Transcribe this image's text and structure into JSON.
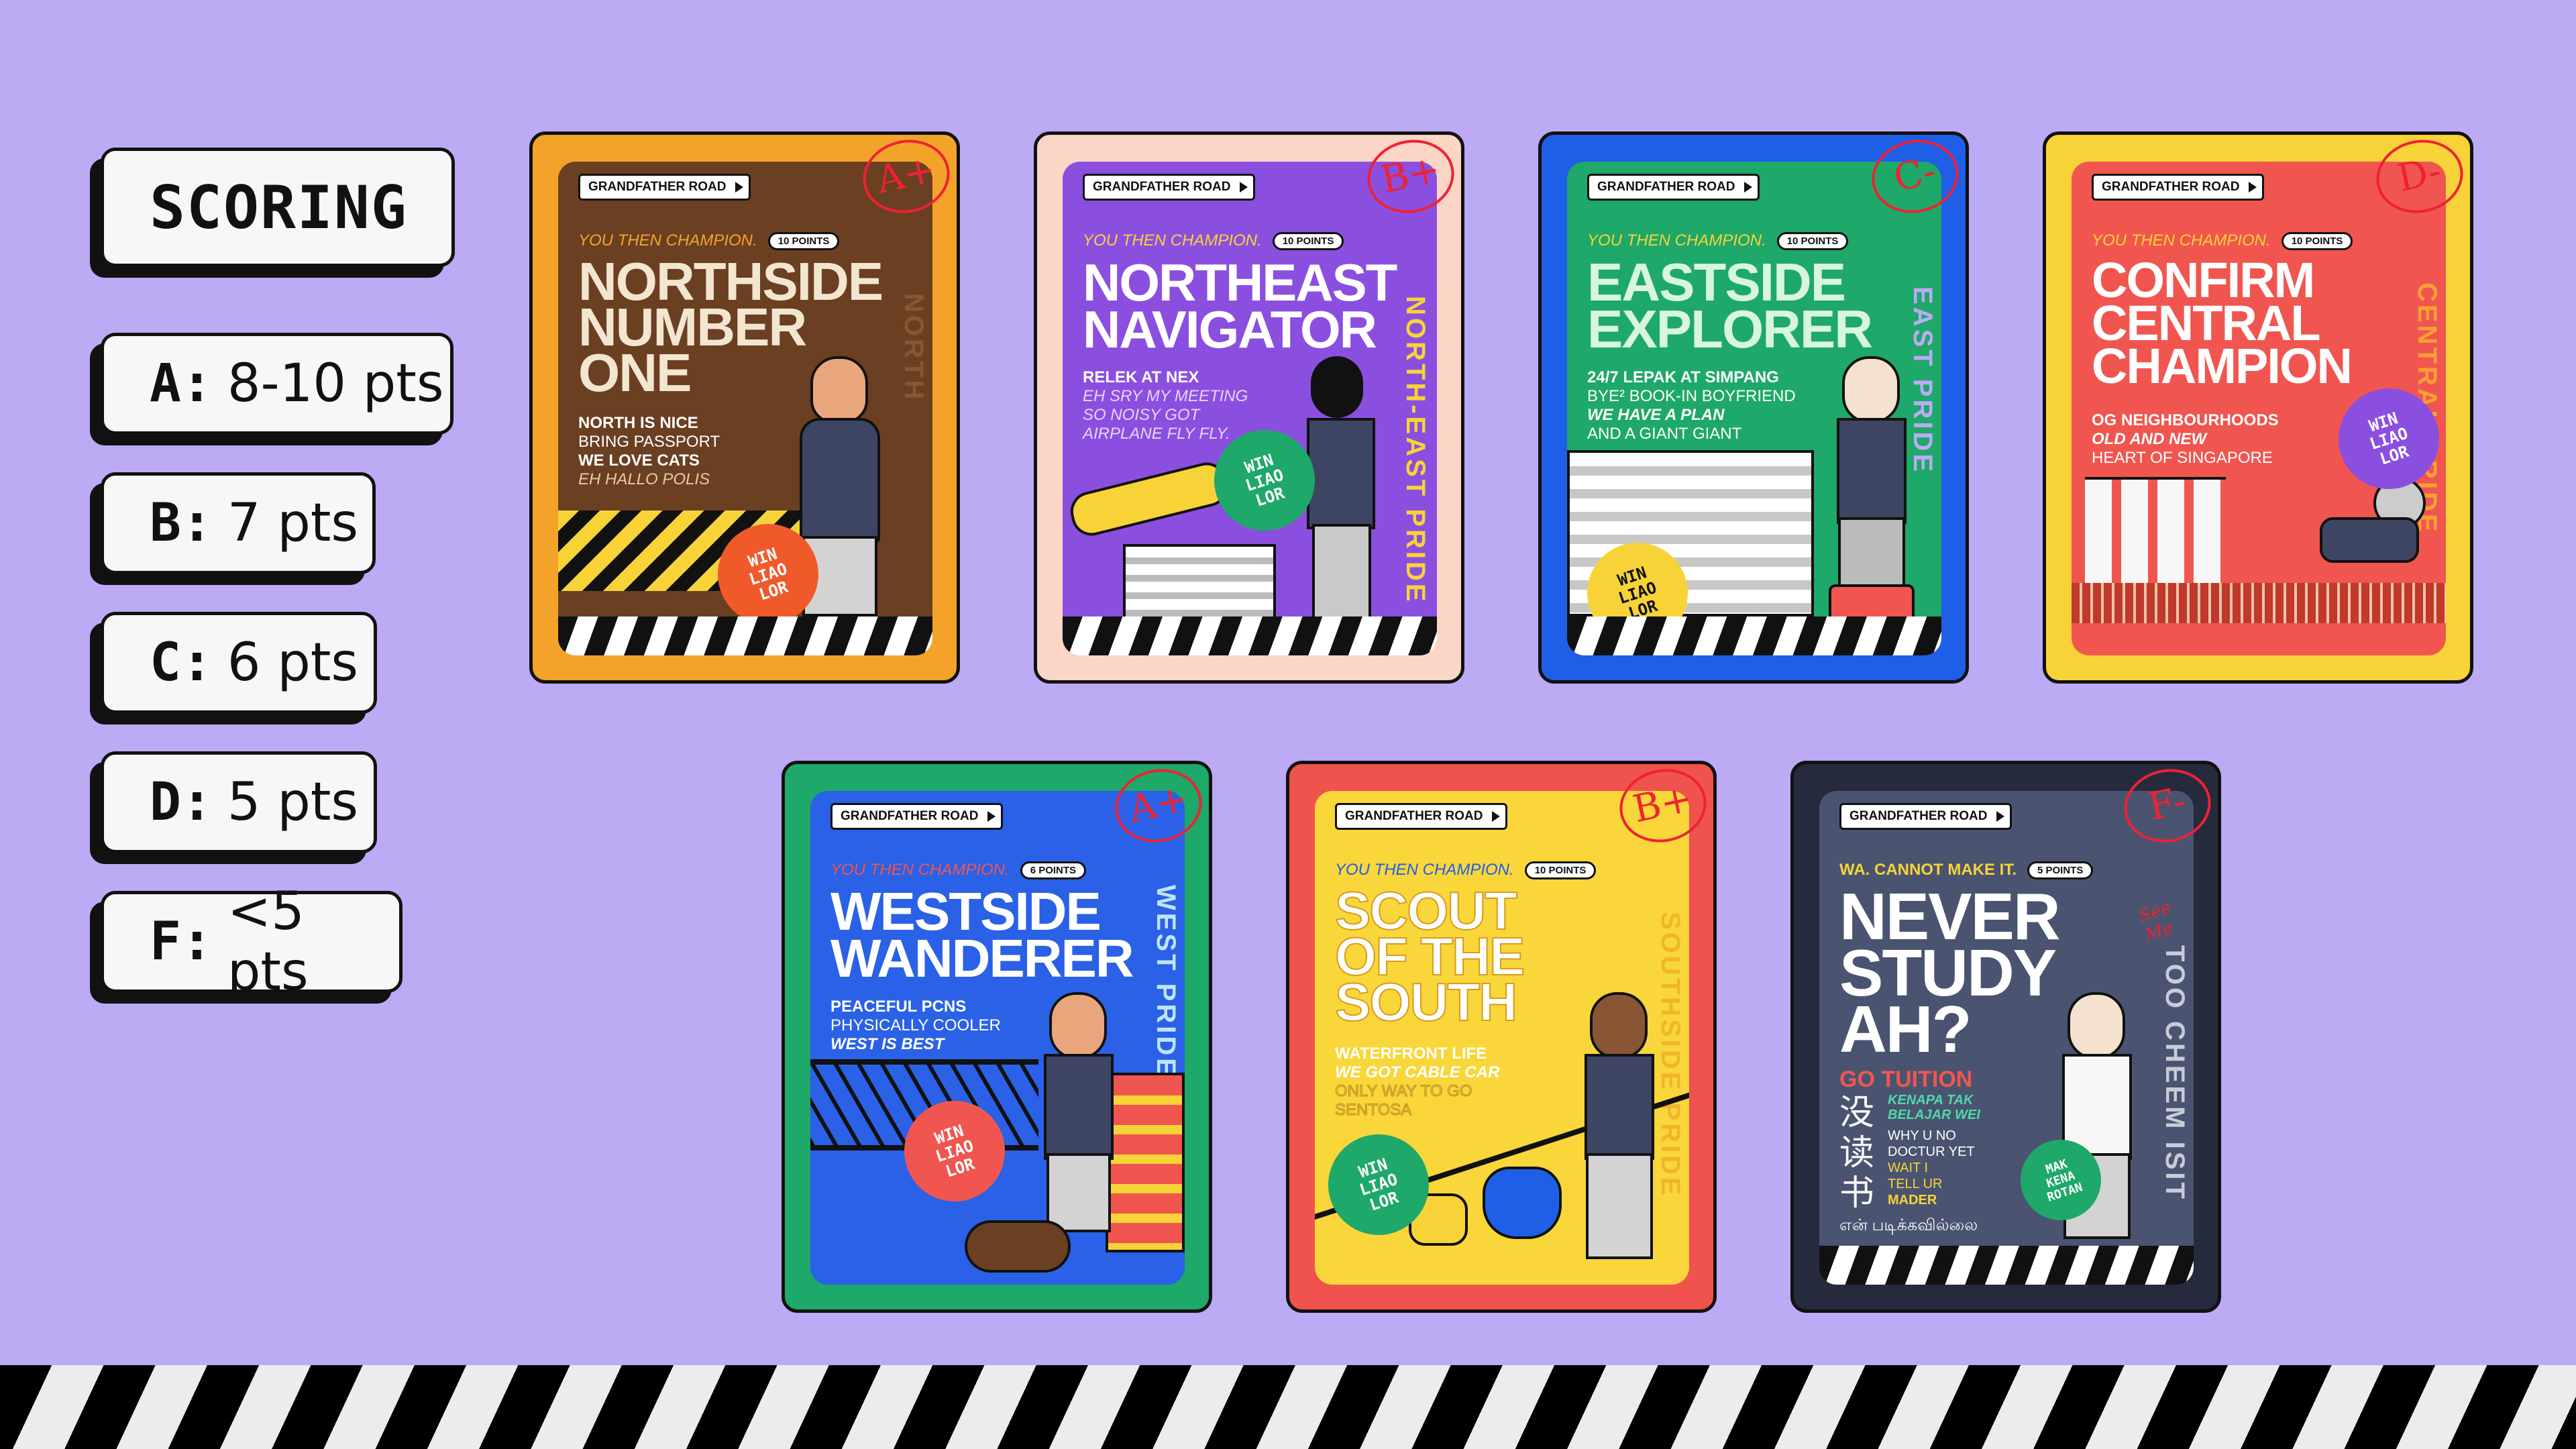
{
  "scoring": {
    "title": "SCORING",
    "grades": [
      {
        "letter": "A:",
        "points": "8-10 pts"
      },
      {
        "letter": "B:",
        "points": "7 pts"
      },
      {
        "letter": "C:",
        "points": "6 pts"
      },
      {
        "letter": "D:",
        "points": "5 pts"
      },
      {
        "letter": "F:",
        "points": "<5 pts"
      }
    ]
  },
  "cards": [
    {
      "brand": "GRANDFATHER ROAD",
      "tagline": "YOU THEN CHAMPION.",
      "points": "10 POINTS",
      "grade": "A+",
      "headline": "NORTHSIDE\nNUMBER\nONE",
      "lines": [
        "NORTH IS NICE",
        "BRING PASSPORT",
        "WE LOVE CATS",
        "EH HALLO POLIS"
      ],
      "side": "NORTH",
      "badge": "WIN\nLIAO\nLOR",
      "colors": {
        "frame": "#f4a32a",
        "panel": "#6b3f22",
        "head": "#f3e6d0",
        "text": "#ffffff"
      }
    },
    {
      "brand": "GRANDFATHER ROAD",
      "tagline": "YOU THEN CHAMPION.",
      "points": "10 POINTS",
      "grade": "B+",
      "headline": "NORTHEAST\nNAVIGATOR",
      "lines": [
        "RELEK AT NEX",
        "EH SRY MY MEETING",
        "SO NOISY GOT",
        "AIRPLANE FLY FLY."
      ],
      "side": "NORTH-EAST PRIDE",
      "badge": "WIN\nLIAO\nLOR",
      "colors": {
        "frame": "#fbd5c6",
        "panel": "#8b4fe0",
        "head": "#ffffff",
        "text": "#ffffff"
      }
    },
    {
      "brand": "GRANDFATHER ROAD",
      "tagline": "YOU THEN CHAMPION.",
      "points": "10 POINTS",
      "grade": "C-",
      "headline": "EASTSIDE\nEXPLORER",
      "lines": [
        "24/7 LEPAK AT SIMPANG",
        "BYE² BOOK-IN BOYFRIEND",
        "WE HAVE A PLAN",
        "AND A GIANT GIANT"
      ],
      "side": "EAST PRIDE",
      "badge": "WIN\nLIAO\nLOR",
      "colors": {
        "frame": "#1f5fe8",
        "panel": "#1ea869",
        "head": "#d7f5df",
        "text": "#ffffff"
      }
    },
    {
      "brand": "GRANDFATHER ROAD",
      "tagline": "YOU THEN CHAMPION.",
      "points": "10 POINTS",
      "grade": "D-",
      "headline": "CONFIRM\nCENTRAL\nCHAMPION",
      "lines": [
        "OG NEIGHBOURHOODS",
        "OLD AND NEW",
        "HEART OF SINGAPORE"
      ],
      "side": "CENTRAL PRIDE",
      "badge": "WIN\nLIAO\nLOR",
      "colors": {
        "frame": "#f8d338",
        "panel": "#f0564f",
        "head": "#ffffff",
        "text": "#ffffff"
      }
    },
    {
      "brand": "GRANDFATHER ROAD",
      "tagline": "YOU THEN CHAMPION.",
      "points": "6 POINTS",
      "grade": "A+",
      "headline": "WESTSIDE\nWANDERER",
      "lines": [
        "PEACEFUL PCNS",
        "PHYSICALLY COOLER",
        "WEST IS BEST"
      ],
      "side": "WEST PRIDE",
      "badge": "WIN\nLIAO\nLOR",
      "colors": {
        "frame": "#1ea869",
        "panel": "#2a61e6",
        "head": "#ffffff",
        "text": "#ffffff"
      }
    },
    {
      "brand": "GRANDFATHER ROAD",
      "tagline": "YOU THEN CHAMPION.",
      "points": "10 POINTS",
      "grade": "B+",
      "headline": "SCOUT\nOF THE\nSOUTH",
      "lines": [
        "WATERFRONT LIFE",
        "WE GOT CABLE CAR",
        "ONLY WAY TO GO",
        "SENTOSA"
      ],
      "side": "SOUTHSIDE PRIDE",
      "badge": "WIN\nLIAO\nLOR",
      "colors": {
        "frame": "#f0524e",
        "panel": "#f9d63a",
        "head": "#ffffff",
        "text": "#ffffff"
      }
    },
    {
      "brand": "GRANDFATHER ROAD",
      "tagline": "WA. CANNOT MAKE IT.",
      "points": "5 POINTS",
      "grade": "F-",
      "headline": "NEVER\nSTUDY\nAH?",
      "lines": [
        "GO TUITION",
        "KENAPA TAK",
        "BELAJAR WEI",
        "WHY U NO",
        "DOCTUR YET",
        "WAIT I",
        "TELL UR",
        "MADER"
      ],
      "side": "TOO CHEEM ISIT",
      "badge": "MAK\nKENA\nROTAN",
      "extra": [
        "没读书",
        "என் படிக்கவில்லை",
        "See Me"
      ],
      "colors": {
        "frame": "#262a3d",
        "panel": "#4a5470",
        "head": "#ffffff",
        "text": "#ffffff"
      }
    }
  ]
}
